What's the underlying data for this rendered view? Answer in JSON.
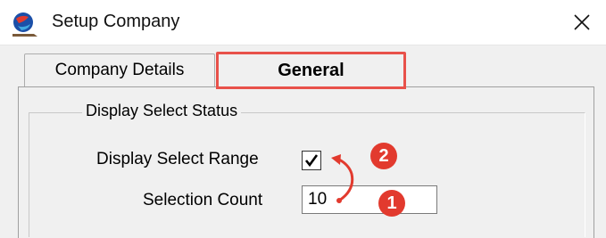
{
  "window": {
    "title": "Setup Company"
  },
  "icons": {
    "app": "globe-app-icon",
    "close": "close-icon"
  },
  "tabs": [
    {
      "label": "Company Details",
      "active": false
    },
    {
      "label": "General",
      "active": true
    }
  ],
  "group": {
    "title": "Display Select Status",
    "display_select_range": {
      "label": "Display Select Range",
      "checked": true
    },
    "selection_count": {
      "label": "Selection Count",
      "value": "10"
    }
  },
  "annotations": {
    "badge_1": "1",
    "badge_2": "2",
    "highlight_color": "#e8514a"
  }
}
